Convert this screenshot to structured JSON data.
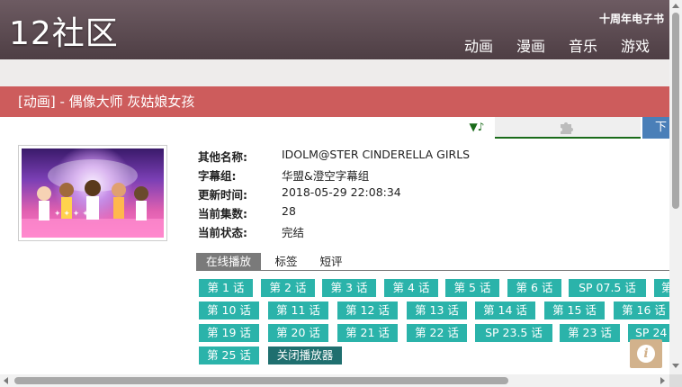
{
  "header": {
    "logo": "12社区",
    "top_link": "十周年电子书",
    "nav": [
      "动画",
      "漫画",
      "音乐",
      "游戏"
    ]
  },
  "title_bar": {
    "text": "[动画] - 偶像大师 灰姑娘女孩",
    "bg_color": "#cd5c5c"
  },
  "player_controls": {
    "music_icon": "▼♪",
    "plugin_icon": "puzzle-icon",
    "download_label": "下"
  },
  "info": {
    "rows": [
      {
        "label": "其他名称:",
        "value": "IDOLM@STER CINDERELLA GIRLS"
      },
      {
        "label": "字幕组:",
        "value": "华盟&澄空字幕组"
      },
      {
        "label": "更新时间:",
        "value": "2018-05-29 22:08:34"
      },
      {
        "label": "当前集数:",
        "value": "28"
      },
      {
        "label": "当前状态:",
        "value": "完结"
      }
    ]
  },
  "tabs": [
    {
      "label": "在线播放",
      "active": true
    },
    {
      "label": "标签",
      "active": false
    },
    {
      "label": "短评",
      "active": false
    }
  ],
  "episodes": {
    "accent_color": "#2bb3aa",
    "items": [
      "第 1 话",
      "第 2 话",
      "第 3 话",
      "第 4 话",
      "第 5 话",
      "第 6 话",
      "SP 07.5 话",
      "第",
      "第 10 话",
      "第 11 话",
      "第 12 话",
      "第 13 话",
      "第 14 话",
      "第 15 话",
      "第 16 话",
      "第 19 话",
      "第 20 话",
      "第 21 话",
      "第 22 话",
      "SP 23.5 话",
      "第 23 话",
      "SP 24",
      "第 25 话"
    ],
    "close_player": "关闭播放器"
  },
  "fab": {
    "icon": "info-icon",
    "glyph": "i"
  }
}
